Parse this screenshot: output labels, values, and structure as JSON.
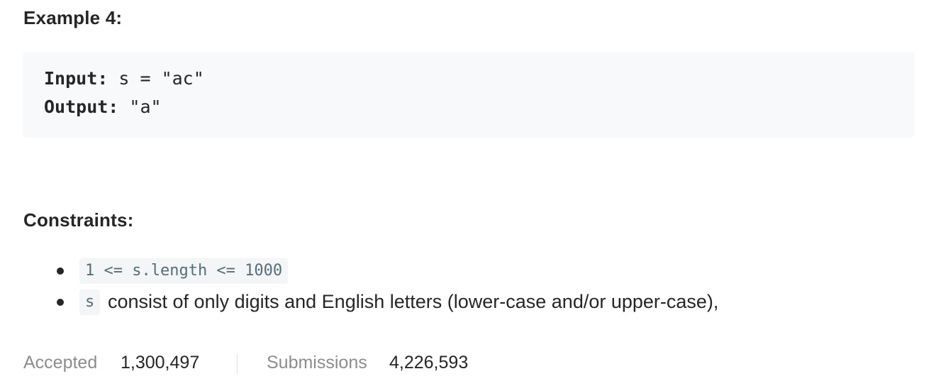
{
  "example": {
    "heading": "Example 4:",
    "input_key": "Input:",
    "input_value": " s = \"ac\"",
    "output_key": "Output:",
    "output_value": " \"a\""
  },
  "constraints": {
    "heading": "Constraints:",
    "items": [
      {
        "code": "1 <= s.length <= 1000",
        "text": ""
      },
      {
        "code": "s",
        "text": "consist of only digits and English letters (lower-case and/or upper-case),"
      }
    ]
  },
  "stats": {
    "accepted_label": "Accepted",
    "accepted_value": "1,300,497",
    "submissions_label": "Submissions",
    "submissions_value": "4,226,593"
  }
}
